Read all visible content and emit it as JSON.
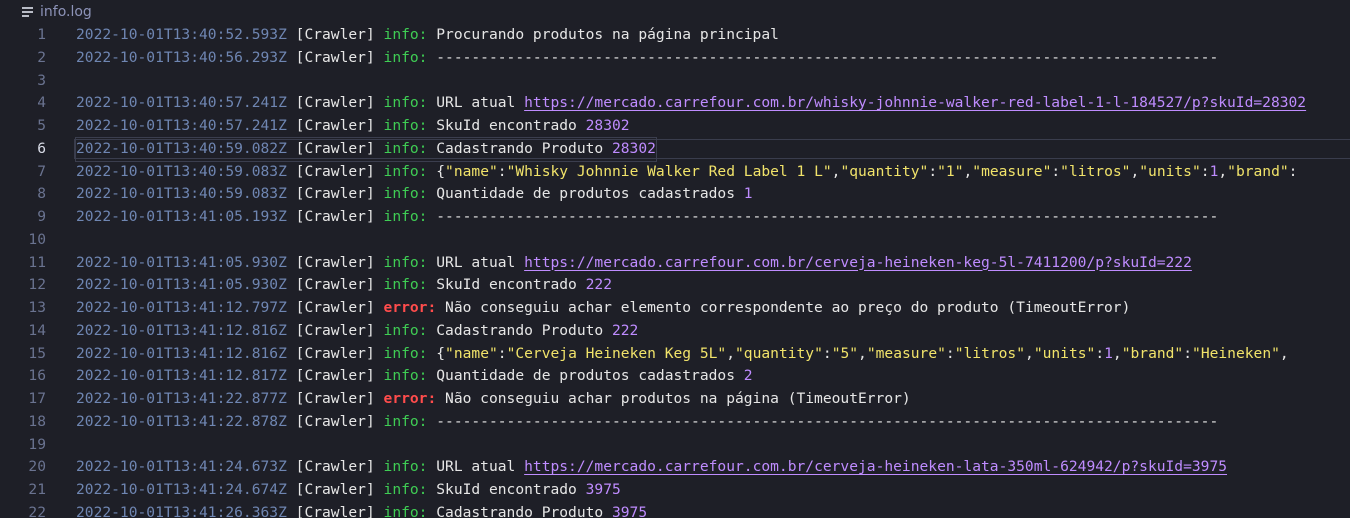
{
  "tab": {
    "label": "info.log",
    "icon": "file-lines-icon"
  },
  "colors": {
    "background": "#1e1f27",
    "timestamp": "#6f86b2",
    "info": "#3fcd54",
    "error": "#ff4c4c",
    "number": "#bf8cff",
    "string": "#f1e36a"
  },
  "lines": [
    {
      "n": "1",
      "parts": [
        [
          "ts",
          "2022-10-01T13:40:52.593Z"
        ],
        [
          "crawler",
          " [Crawler] "
        ],
        [
          "info",
          "info:"
        ],
        [
          "msg",
          " Procurando produtos na página principal"
        ]
      ]
    },
    {
      "n": "2",
      "parts": [
        [
          "ts",
          "2022-10-01T13:40:56.293Z"
        ],
        [
          "crawler",
          " [Crawler] "
        ],
        [
          "info",
          "info:"
        ],
        [
          "dash",
          " -----------------------------------------------------------------------------------------"
        ]
      ]
    },
    {
      "n": "3",
      "parts": []
    },
    {
      "n": "4",
      "parts": [
        [
          "ts",
          "2022-10-01T13:40:57.241Z"
        ],
        [
          "crawler",
          " [Crawler] "
        ],
        [
          "info",
          "info:"
        ],
        [
          "msg",
          " URL atual "
        ],
        [
          "link",
          "https://mercado.carrefour.com.br/whisky-johnnie-walker-red-label-1-l-184527/p?skuId=28302"
        ]
      ]
    },
    {
      "n": "5",
      "parts": [
        [
          "ts",
          "2022-10-01T13:40:57.241Z"
        ],
        [
          "crawler",
          " [Crawler] "
        ],
        [
          "info",
          "info:"
        ],
        [
          "msg",
          " SkuId encontrado "
        ],
        [
          "num",
          "28302"
        ]
      ]
    },
    {
      "n": "6",
      "current": true,
      "parts": [
        [
          "ts",
          "2022-10-01T13:40:59.082Z"
        ],
        [
          "crawler",
          " [Crawler] "
        ],
        [
          "info",
          "info:"
        ],
        [
          "msg",
          " Cadastrando Produto "
        ],
        [
          "num",
          "28302"
        ]
      ]
    },
    {
      "n": "7",
      "parts": [
        [
          "ts",
          "2022-10-01T13:40:59.083Z"
        ],
        [
          "crawler",
          " [Crawler] "
        ],
        [
          "info",
          "info:"
        ],
        [
          "msg",
          " {"
        ],
        [
          "str",
          "\"name\""
        ],
        [
          "msg",
          ":"
        ],
        [
          "str",
          "\"Whisky Johnnie Walker Red Label 1 L\""
        ],
        [
          "msg",
          ","
        ],
        [
          "str",
          "\"quantity\""
        ],
        [
          "msg",
          ":"
        ],
        [
          "str",
          "\"1\""
        ],
        [
          "msg",
          ","
        ],
        [
          "str",
          "\"measure\""
        ],
        [
          "msg",
          ":"
        ],
        [
          "str",
          "\"litros\""
        ],
        [
          "msg",
          ","
        ],
        [
          "str",
          "\"units\""
        ],
        [
          "msg",
          ":"
        ],
        [
          "num",
          "1"
        ],
        [
          "msg",
          ","
        ],
        [
          "str",
          "\"brand\""
        ],
        [
          "msg",
          ":"
        ]
      ]
    },
    {
      "n": "8",
      "parts": [
        [
          "ts",
          "2022-10-01T13:40:59.083Z"
        ],
        [
          "crawler",
          " [Crawler] "
        ],
        [
          "info",
          "info:"
        ],
        [
          "msg",
          " Quantidade de produtos cadastrados "
        ],
        [
          "num",
          "1"
        ]
      ]
    },
    {
      "n": "9",
      "parts": [
        [
          "ts",
          "2022-10-01T13:41:05.193Z"
        ],
        [
          "crawler",
          " [Crawler] "
        ],
        [
          "info",
          "info:"
        ],
        [
          "dash",
          " -----------------------------------------------------------------------------------------"
        ]
      ]
    },
    {
      "n": "10",
      "parts": []
    },
    {
      "n": "11",
      "parts": [
        [
          "ts",
          "2022-10-01T13:41:05.930Z"
        ],
        [
          "crawler",
          " [Crawler] "
        ],
        [
          "info",
          "info:"
        ],
        [
          "msg",
          " URL atual "
        ],
        [
          "link",
          "https://mercado.carrefour.com.br/cerveja-heineken-keg-5l-7411200/p?skuId=222"
        ]
      ]
    },
    {
      "n": "12",
      "parts": [
        [
          "ts",
          "2022-10-01T13:41:05.930Z"
        ],
        [
          "crawler",
          " [Crawler] "
        ],
        [
          "info",
          "info:"
        ],
        [
          "msg",
          " SkuId encontrado "
        ],
        [
          "num",
          "222"
        ]
      ]
    },
    {
      "n": "13",
      "parts": [
        [
          "ts",
          "2022-10-01T13:41:12.797Z"
        ],
        [
          "crawler",
          " [Crawler] "
        ],
        [
          "error",
          "error:"
        ],
        [
          "msg",
          " Não conseguiu achar elemento correspondente ao preço do produto (TimeoutError)"
        ]
      ]
    },
    {
      "n": "14",
      "parts": [
        [
          "ts",
          "2022-10-01T13:41:12.816Z"
        ],
        [
          "crawler",
          " [Crawler] "
        ],
        [
          "info",
          "info:"
        ],
        [
          "msg",
          " Cadastrando Produto "
        ],
        [
          "num",
          "222"
        ]
      ]
    },
    {
      "n": "15",
      "parts": [
        [
          "ts",
          "2022-10-01T13:41:12.816Z"
        ],
        [
          "crawler",
          " [Crawler] "
        ],
        [
          "info",
          "info:"
        ],
        [
          "msg",
          " {"
        ],
        [
          "str",
          "\"name\""
        ],
        [
          "msg",
          ":"
        ],
        [
          "str",
          "\"Cerveja Heineken Keg 5L\""
        ],
        [
          "msg",
          ","
        ],
        [
          "str",
          "\"quantity\""
        ],
        [
          "msg",
          ":"
        ],
        [
          "str",
          "\"5\""
        ],
        [
          "msg",
          ","
        ],
        [
          "str",
          "\"measure\""
        ],
        [
          "msg",
          ":"
        ],
        [
          "str",
          "\"litros\""
        ],
        [
          "msg",
          ","
        ],
        [
          "str",
          "\"units\""
        ],
        [
          "msg",
          ":"
        ],
        [
          "num",
          "1"
        ],
        [
          "msg",
          ","
        ],
        [
          "str",
          "\"brand\""
        ],
        [
          "msg",
          ":"
        ],
        [
          "str",
          "\"Heineken\""
        ],
        [
          "msg",
          ","
        ]
      ]
    },
    {
      "n": "16",
      "parts": [
        [
          "ts",
          "2022-10-01T13:41:12.817Z"
        ],
        [
          "crawler",
          " [Crawler] "
        ],
        [
          "info",
          "info:"
        ],
        [
          "msg",
          " Quantidade de produtos cadastrados "
        ],
        [
          "num",
          "2"
        ]
      ]
    },
    {
      "n": "17",
      "parts": [
        [
          "ts",
          "2022-10-01T13:41:22.877Z"
        ],
        [
          "crawler",
          " [Crawler] "
        ],
        [
          "error",
          "error:"
        ],
        [
          "msg",
          " Não conseguiu achar produtos na página (TimeoutError)"
        ]
      ]
    },
    {
      "n": "18",
      "parts": [
        [
          "ts",
          "2022-10-01T13:41:22.878Z"
        ],
        [
          "crawler",
          " [Crawler] "
        ],
        [
          "info",
          "info:"
        ],
        [
          "dash",
          " -----------------------------------------------------------------------------------------"
        ]
      ]
    },
    {
      "n": "19",
      "parts": []
    },
    {
      "n": "20",
      "parts": [
        [
          "ts",
          "2022-10-01T13:41:24.673Z"
        ],
        [
          "crawler",
          " [Crawler] "
        ],
        [
          "info",
          "info:"
        ],
        [
          "msg",
          " URL atual "
        ],
        [
          "link",
          "https://mercado.carrefour.com.br/cerveja-heineken-lata-350ml-624942/p?skuId=3975"
        ]
      ]
    },
    {
      "n": "21",
      "parts": [
        [
          "ts",
          "2022-10-01T13:41:24.674Z"
        ],
        [
          "crawler",
          " [Crawler] "
        ],
        [
          "info",
          "info:"
        ],
        [
          "msg",
          " SkuId encontrado "
        ],
        [
          "num",
          "3975"
        ]
      ]
    },
    {
      "n": "22",
      "parts": [
        [
          "ts",
          "2022-10-01T13:41:26.363Z"
        ],
        [
          "crawler",
          " [Crawler] "
        ],
        [
          "info",
          "info:"
        ],
        [
          "msg",
          " Cadastrando Produto "
        ],
        [
          "num",
          "3975"
        ]
      ]
    }
  ]
}
